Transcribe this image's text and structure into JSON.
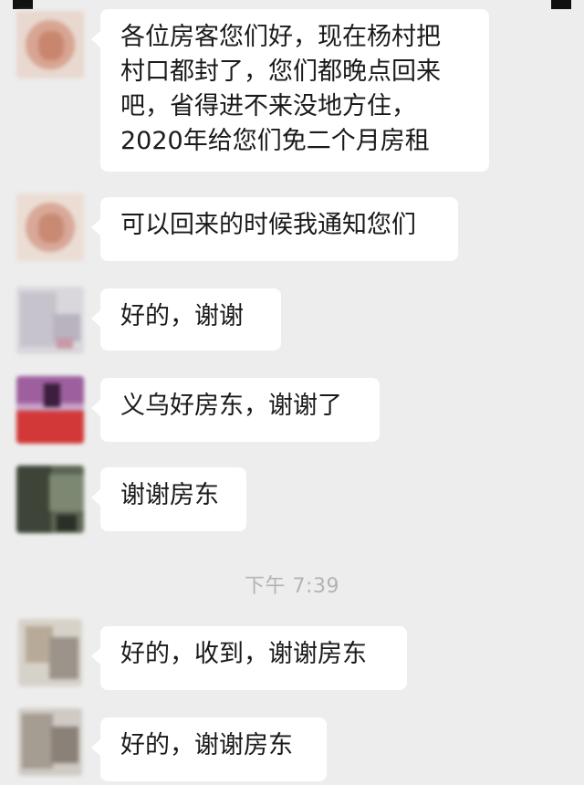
{
  "conversation": {
    "messages": [
      {
        "sender": "contact-a",
        "text": "各位房客您们好，现在杨村把\n村口都封了，您们都晚点回来\n吧，省得进不来没地方住，\n2020年给您们免二个月房租"
      },
      {
        "sender": "contact-a",
        "text": "可以回来的时候我通知您们"
      },
      {
        "sender": "contact-b",
        "text": "好的，谢谢"
      },
      {
        "sender": "contact-c",
        "text": "义乌好房东，谢谢了"
      },
      {
        "sender": "contact-d",
        "text": "谢谢房东"
      },
      {
        "sender": "contact-e",
        "text": "好的，收到，谢谢房东"
      },
      {
        "sender": "contact-f",
        "text": "好的，谢谢房东"
      }
    ],
    "timestamp": "下午 7:39"
  },
  "colors": {
    "background": "#ededed",
    "bubble": "#ffffff",
    "text": "#1a1a1a",
    "timestamp": "#b3b3b3"
  }
}
